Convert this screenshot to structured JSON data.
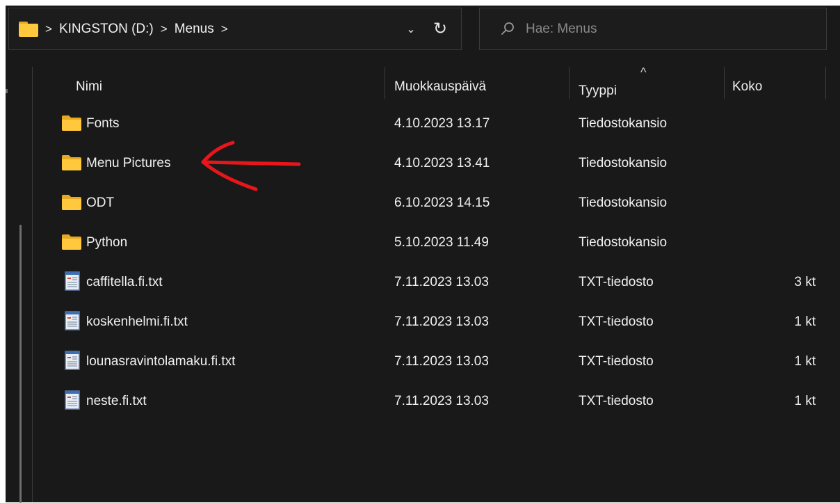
{
  "address": {
    "breadcrumbs": [
      "KINGSTON (D:)",
      "Menus"
    ],
    "separator": ">",
    "history_chevron": "⌄",
    "refresh_glyph": "↻"
  },
  "search": {
    "placeholder": "Hae: Menus",
    "value": ""
  },
  "columns": {
    "name": "Nimi",
    "modified": "Muokkauspäivä",
    "type": "Tyyppi",
    "size": "Koko",
    "sort_glyph": "^"
  },
  "rows": [
    {
      "name": "Fonts",
      "modified": "4.10.2023 13.17",
      "type": "Tiedostokansio",
      "size": "",
      "kind": "folder"
    },
    {
      "name": "Menu Pictures",
      "modified": "4.10.2023 13.41",
      "type": "Tiedostokansio",
      "size": "",
      "kind": "folder"
    },
    {
      "name": "ODT",
      "modified": "6.10.2023 14.15",
      "type": "Tiedostokansio",
      "size": "",
      "kind": "folder"
    },
    {
      "name": "Python",
      "modified": "5.10.2023 11.49",
      "type": "Tiedostokansio",
      "size": "",
      "kind": "folder"
    },
    {
      "name": "caffitella.fi.txt",
      "modified": "7.11.2023 13.03",
      "type": "TXT-tiedosto",
      "size": "3 kt",
      "kind": "txt"
    },
    {
      "name": "koskenhelmi.fi.txt",
      "modified": "7.11.2023 13.03",
      "type": "TXT-tiedosto",
      "size": "1 kt",
      "kind": "txt"
    },
    {
      "name": "lounasravintolamaku.fi.txt",
      "modified": "7.11.2023 13.03",
      "type": "TXT-tiedosto",
      "size": "1 kt",
      "kind": "txt"
    },
    {
      "name": "neste.fi.txt",
      "modified": "7.11.2023 13.03",
      "type": "TXT-tiedosto",
      "size": "1 kt",
      "kind": "txt"
    }
  ],
  "colors": {
    "background": "#191919",
    "folder": "#ffc83d",
    "annotation_arrow": "#e8161b"
  },
  "icons": {
    "address_folder": "folder-icon",
    "search": "search-icon",
    "folder": "folder-icon",
    "txt": "text-file-icon"
  }
}
